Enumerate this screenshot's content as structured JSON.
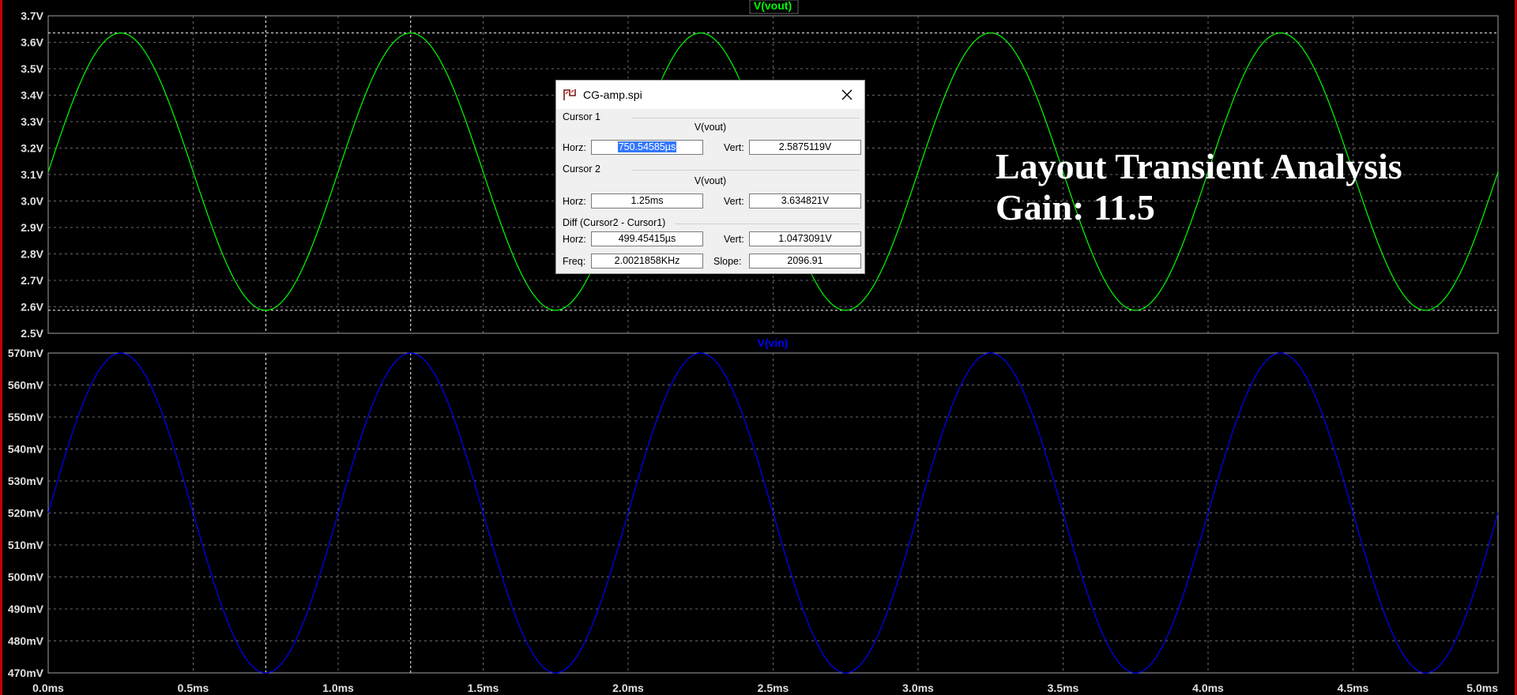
{
  "window": {
    "title": "CG-amp.spi",
    "overlay_title": "Layout Transient Analysis",
    "overlay_gain": "Gain: 11.5"
  },
  "top_pane": {
    "trace_label": "V(vout)",
    "trace_color": "#00ff00",
    "y_ticks": [
      "3.7V",
      "3.6V",
      "3.5V",
      "3.4V",
      "3.3V",
      "3.2V",
      "3.1V",
      "3.0V",
      "2.9V",
      "2.8V",
      "2.7V",
      "2.6V",
      "2.5V"
    ]
  },
  "bottom_pane": {
    "trace_label": "V(vin)",
    "trace_color": "#0000ff",
    "y_ticks": [
      "570mV",
      "560mV",
      "550mV",
      "540mV",
      "530mV",
      "520mV",
      "510mV",
      "500mV",
      "490mV",
      "480mV",
      "470mV"
    ]
  },
  "x_ticks": [
    "0.0ms",
    "0.5ms",
    "1.0ms",
    "1.5ms",
    "2.0ms",
    "2.5ms",
    "3.0ms",
    "3.5ms",
    "4.0ms",
    "4.5ms",
    "5.0ms"
  ],
  "cursor_dialog": {
    "cursor1_group": "Cursor 1",
    "cursor1_trace": "V(vout)",
    "cursor1_horz_label": "Horz:",
    "cursor1_horz": "750.54585µs",
    "cursor1_vert_label": "Vert:",
    "cursor1_vert": "2.5875119V",
    "cursor2_group": "Cursor 2",
    "cursor2_trace": "V(vout)",
    "cursor2_horz_label": "Horz:",
    "cursor2_horz": "1.25ms",
    "cursor2_vert_label": "Vert:",
    "cursor2_vert": "3.634821V",
    "diff_group": "Diff (Cursor2 - Cursor1)",
    "diff_horz_label": "Horz:",
    "diff_horz": "499.45415µs",
    "diff_vert_label": "Vert:",
    "diff_vert": "1.0473091V",
    "freq_label": "Freq:",
    "freq": "2.0021858KHz",
    "slope_label": "Slope:",
    "slope": "2096.91"
  },
  "chart_data": [
    {
      "type": "line",
      "title": "V(vout)",
      "xlim": [
        0,
        5.0
      ],
      "ylim": [
        2.5,
        3.7
      ],
      "grid": true,
      "series": [
        {
          "name": "V(vout)",
          "color": "#00ff00",
          "x": [
            0,
            0.25,
            0.5,
            0.75,
            1.0,
            1.25,
            1.5,
            1.75,
            2.0,
            2.25,
            2.5,
            2.75,
            3.0,
            3.25,
            3.5,
            3.75,
            4.0,
            4.25,
            4.5,
            4.75,
            5.0
          ],
          "y": [
            3.11,
            3.635,
            3.11,
            2.587,
            3.11,
            3.635,
            3.11,
            2.587,
            3.11,
            3.635,
            3.11,
            2.587,
            3.11,
            3.635,
            3.11,
            2.587,
            3.11,
            3.635,
            3.11,
            2.587,
            3.11
          ]
        }
      ],
      "cursors": {
        "horizontal": [
          3.635,
          2.587
        ],
        "vertical": [
          0.7505,
          1.25
        ]
      }
    },
    {
      "type": "line",
      "title": "V(vin)",
      "xlim": [
        0,
        5.0
      ],
      "ylim": [
        470,
        570
      ],
      "grid": true,
      "series": [
        {
          "name": "V(vin)",
          "color": "#0000ff",
          "x": [
            0,
            0.25,
            0.5,
            0.75,
            1.0,
            1.25,
            1.5,
            1.75,
            2.0,
            2.25,
            2.5,
            2.75,
            3.0,
            3.25,
            3.5,
            3.75,
            4.0,
            4.25,
            4.5,
            4.75,
            5.0
          ],
          "y": [
            520,
            570,
            520,
            470,
            520,
            570,
            520,
            470,
            520,
            570,
            520,
            470,
            520,
            570,
            520,
            470,
            520,
            570,
            520,
            470,
            520
          ]
        }
      ],
      "cursors": {
        "vertical": [
          0.7505,
          1.25
        ]
      }
    }
  ]
}
